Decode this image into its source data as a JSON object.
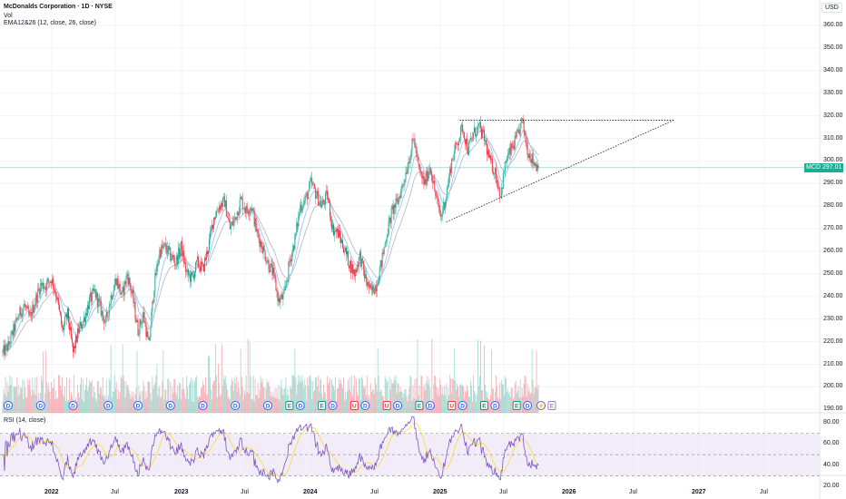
{
  "header": {
    "title": "McDonalds Corporation · 1D · NYSE",
    "volume_label": "Vol",
    "ema_label": "EMA12&26 (12, close, 26, close)",
    "rsi_label": "RSI (14, close)",
    "currency": "USD"
  },
  "current_price": {
    "symbol": "MCD",
    "value": "297.01",
    "price": 297.01,
    "color": "#22ab94"
  },
  "colors": {
    "up": "#22ab94",
    "down": "#f23645",
    "ema_fast": "#90bff9",
    "ema_slow": "#b2b5be",
    "rsi": "#7e57c2",
    "rsi_ma": "#fdd835",
    "rsi_band": "#ede7f6"
  },
  "price_axis": {
    "ticks": [
      "360.00",
      "350.00",
      "340.00",
      "330.00",
      "320.00",
      "310.00",
      "300.00",
      "290.00",
      "280.00",
      "270.00",
      "260.00",
      "250.00",
      "240.00",
      "230.00",
      "220.00",
      "210.00",
      "200.00",
      "190.00"
    ]
  },
  "rsi_axis": {
    "ticks": [
      "80.00",
      "60.00",
      "40.00",
      "20.00"
    ]
  },
  "time_axis": {
    "ticks": [
      "2022",
      "Jul",
      "2023",
      "Jul",
      "2024",
      "Jul",
      "2025",
      "Jul",
      "2026",
      "Jul",
      "2027",
      "Jul"
    ]
  },
  "chart_data": {
    "type": "candlestick",
    "title": "McDonalds Corporation · 1D · NYSE",
    "x_unit": "months since first bar",
    "ylim": [
      190,
      360
    ],
    "rsi_ylim": [
      10,
      90
    ],
    "rsi_levels": [
      70,
      50,
      30
    ],
    "monthly_closes": [
      215,
      218,
      225,
      232,
      236,
      230,
      238,
      245,
      245,
      248,
      240,
      225,
      232,
      215,
      225,
      230,
      238,
      242,
      235,
      228,
      240,
      248,
      240,
      250,
      240,
      225,
      232,
      218,
      245,
      260,
      262,
      258,
      255,
      262,
      250,
      248,
      255,
      252,
      262,
      275,
      280,
      282,
      270,
      275,
      283,
      278,
      280,
      268,
      262,
      255,
      250,
      238,
      240,
      255,
      265,
      280,
      283,
      290,
      285,
      280,
      285,
      270,
      268,
      262,
      255,
      250,
      258,
      248,
      242,
      245,
      255,
      268,
      278,
      282,
      290,
      300,
      310,
      295,
      290,
      298,
      285,
      275,
      285,
      300,
      308,
      315,
      305,
      312,
      315,
      310,
      300,
      295,
      285,
      300,
      305,
      310,
      318,
      305,
      300,
      297
    ],
    "events": [
      {
        "type": "dividend",
        "label": "D",
        "month": 1
      },
      {
        "type": "dividend",
        "label": "D",
        "month": 7
      },
      {
        "type": "dividend",
        "label": "D",
        "month": 13
      },
      {
        "type": "dividend",
        "label": "D",
        "month": 19.5
      },
      {
        "type": "dividend",
        "label": "D",
        "month": 25
      },
      {
        "type": "dividend",
        "label": "D",
        "month": 31
      },
      {
        "type": "dividend",
        "label": "D",
        "month": 37
      },
      {
        "type": "dividend",
        "label": "D",
        "month": 43
      },
      {
        "type": "dividend",
        "label": "D",
        "month": 49
      },
      {
        "type": "earnings",
        "label": "E",
        "month": 53
      },
      {
        "type": "dividend",
        "label": "D",
        "month": 55
      },
      {
        "type": "earnings",
        "label": "E",
        "month": 59
      },
      {
        "type": "dividend",
        "label": "D",
        "month": 61
      },
      {
        "type": "update",
        "label": "U",
        "month": 65
      },
      {
        "type": "dividend",
        "label": "D",
        "month": 67
      },
      {
        "type": "update",
        "label": "U",
        "month": 71
      },
      {
        "type": "dividend",
        "label": "D",
        "month": 73
      },
      {
        "type": "earnings",
        "label": "E",
        "month": 77
      },
      {
        "type": "dividend",
        "label": "D",
        "month": 79
      },
      {
        "type": "update",
        "label": "U",
        "month": 83
      },
      {
        "type": "dividend",
        "label": "D",
        "month": 85
      },
      {
        "type": "earnings",
        "label": "E",
        "month": 89
      },
      {
        "type": "dividend",
        "label": "D",
        "month": 91
      },
      {
        "type": "earnings",
        "label": "E",
        "month": 95
      },
      {
        "type": "dividend",
        "label": "D",
        "month": 97
      },
      {
        "type": "split",
        "label": "⚡",
        "month": 99.5
      },
      {
        "type": "future-earnings",
        "label": "E",
        "month": 101.5
      }
    ],
    "drawings": [
      {
        "type": "horizontal-dotted",
        "from": [
          84.5,
          318
        ],
        "to": [
          124,
          318
        ]
      },
      {
        "type": "trend-dotted",
        "from": [
          82,
          273
        ],
        "to": [
          124,
          318
        ]
      }
    ]
  }
}
